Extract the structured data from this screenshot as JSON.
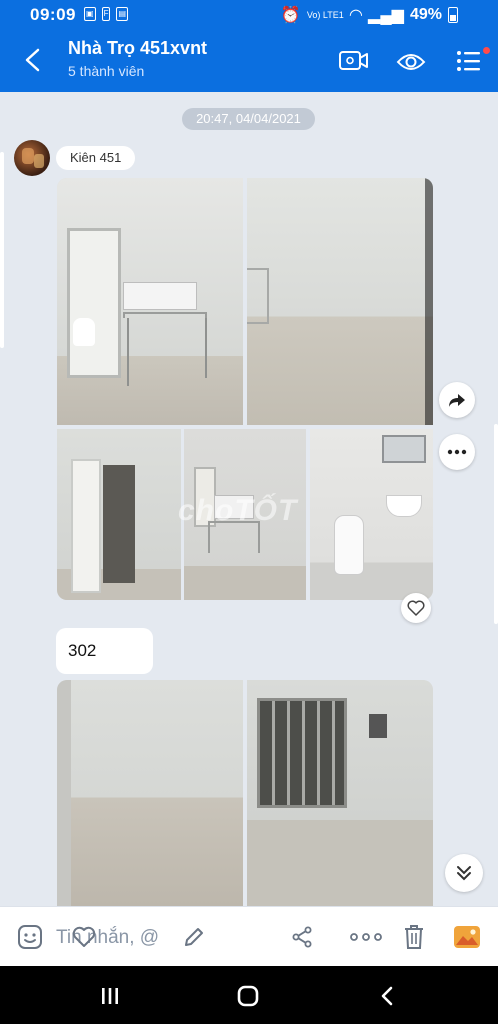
{
  "status_bar": {
    "time": "09:09",
    "battery": "49%",
    "network": "Vo) LTE1"
  },
  "header": {
    "title": "Nhà Trọ 451xvnt",
    "subtitle": "5 thành viên"
  },
  "chat": {
    "date_separator": "20:47, 04/04/2021",
    "sender_name": "Kiên 451",
    "text_message": "302",
    "watermark": "choTỐT"
  },
  "input": {
    "placeholder": "Tin nhắn, @"
  },
  "colors": {
    "brand_blue": "#0b6fe0",
    "chat_bg": "#e4e9f0"
  }
}
